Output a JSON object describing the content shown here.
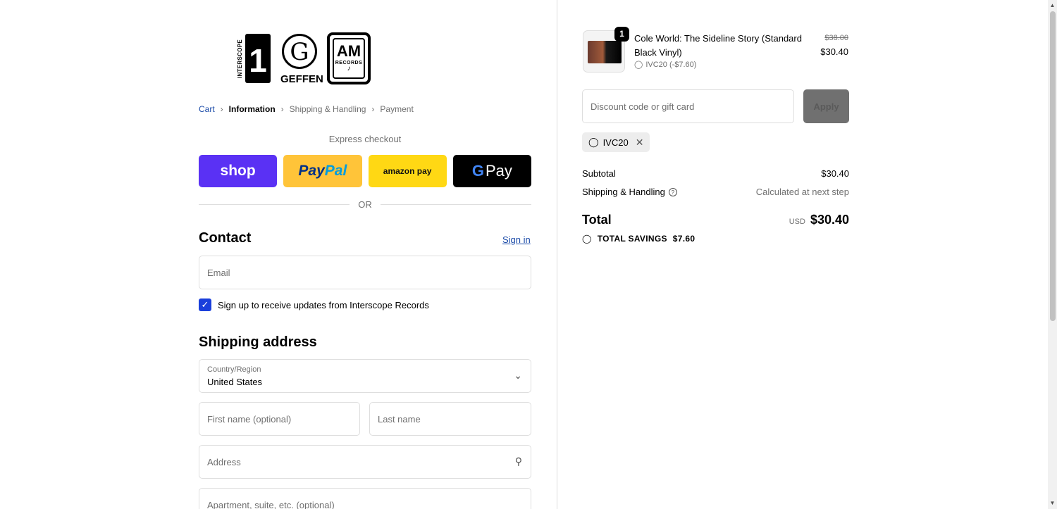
{
  "brands": {
    "interscope_text": "INTERSCOPE",
    "interscope_number": "1",
    "interscope_records": "RECORDS",
    "geffen_letter": "G",
    "geffen_name": "GEFFEN",
    "am_letters": "AM",
    "am_records": "RECORDS"
  },
  "breadcrumb": {
    "cart": "Cart",
    "information": "Information",
    "shipping": "Shipping & Handling",
    "payment": "Payment"
  },
  "express": {
    "label": "Express checkout",
    "shop": "shop",
    "paypal_a": "Pay",
    "paypal_b": "Pal",
    "amazon": "amazon pay",
    "gpay_g": "G",
    "gpay_pay": "Pay"
  },
  "divider": {
    "or": "OR"
  },
  "contact": {
    "title": "Contact",
    "signin": "Sign in",
    "email_placeholder": "Email",
    "newsletter_label": "Sign up to receive updates from Interscope Records",
    "newsletter_checked": true
  },
  "shipping": {
    "title": "Shipping address",
    "country_label": "Country/Region",
    "country_value": "United States",
    "first_name_placeholder": "First name (optional)",
    "last_name_placeholder": "Last name",
    "address_placeholder": "Address",
    "apartment_placeholder": "Apartment, suite, etc. (optional)"
  },
  "order": {
    "quantity": "1",
    "product_name": "Cole World: The Sideline Story (Standard Black Vinyl)",
    "discount_line": "IVC20 (-$7.60)",
    "price_original": "$38.00",
    "price_final": "$30.40"
  },
  "discount": {
    "placeholder": "Discount code or gift card",
    "apply_label": "Apply",
    "applied_code": "IVC20"
  },
  "summary": {
    "subtotal_label": "Subtotal",
    "subtotal_value": "$30.40",
    "shipping_label": "Shipping & Handling",
    "shipping_value": "Calculated at next step",
    "total_label": "Total",
    "currency": "USD",
    "total_value": "$30.40",
    "savings_label": "TOTAL SAVINGS",
    "savings_value": "$7.60"
  },
  "colors": {
    "shop_pay": "#5a31f4",
    "paypal": "#ffc439",
    "amazon_pay": "#ffd814",
    "google_pay": "#000000",
    "link": "#1a4aa8",
    "checkbox": "#1a3fdb"
  }
}
